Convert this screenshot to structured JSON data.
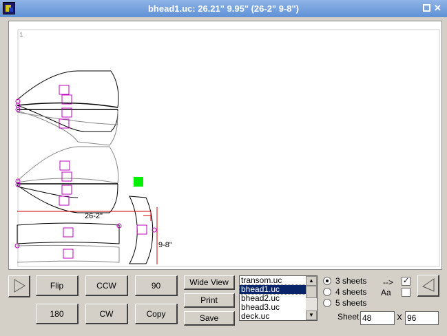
{
  "window": {
    "title": "bhead1.uc: 26.21\" 9.95\" (26-2\" 9-8\")",
    "close_glyph": "✕"
  },
  "canvas": {
    "page_number": "1",
    "dim_horizontal": "26-2\"",
    "dim_vertical": "9-8\"",
    "colors": {
      "outline": "#000000",
      "marker": "#c000c0",
      "dimension": "#cc0000",
      "selected": "#00ee00"
    }
  },
  "toolbar": {
    "left_arrow_icon": "play-triangle-icon",
    "flip": "Flip",
    "ccw": "CCW",
    "rot90": "90",
    "rot180": "180",
    "cw": "CW",
    "copy": "Copy",
    "wide_view": "Wide View",
    "print": "Print",
    "save": "Save"
  },
  "files": {
    "items": [
      "transom.uc",
      "bhead1.uc",
      "bhead2.uc",
      "bhead3.uc",
      "deck.uc"
    ],
    "selected": "bhead1.uc"
  },
  "sheets": {
    "options": [
      "3 sheets",
      "4 sheets",
      "5 sheets"
    ],
    "selected": "3 sheets",
    "arrow_label": "-->",
    "arrow_checked": true,
    "font_label": "Aa",
    "font_checked": false,
    "sheet_label": "Sheet",
    "width": "48",
    "x_label": "X",
    "height": "96"
  }
}
